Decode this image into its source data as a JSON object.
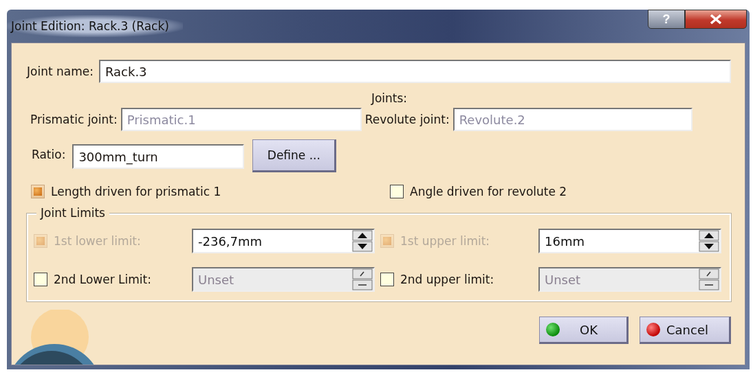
{
  "window": {
    "title": "Joint Edition: Rack.3 (Rack)",
    "help_button": "?"
  },
  "joint_name": {
    "label": "Joint name:",
    "value": "Rack.3"
  },
  "joints": {
    "heading": "Joints:",
    "fields": [
      {
        "label": "Prismatic joint:",
        "value": "Prismatic.1",
        "disabled": true
      },
      {
        "label": "Revolute joint:",
        "value": "Revolute.2",
        "disabled": true
      }
    ]
  },
  "ratio": {
    "label": "Ratio:",
    "value": "300mm_turn",
    "button": "Define ..."
  },
  "drive_options": [
    {
      "label": "Length driven for prismatic 1",
      "checked": true
    },
    {
      "label": "Angle driven for revolute 2",
      "checked": false
    }
  ],
  "joint_limits": {
    "title": "Joint Limits",
    "limits": [
      {
        "label": "1st lower limit:",
        "checked": true,
        "disabled": true,
        "value": "-236,7mm",
        "value_disabled": false
      },
      {
        "label": "1st upper limit:",
        "checked": true,
        "disabled": true,
        "value": "16mm",
        "value_disabled": false
      },
      {
        "label": "2nd Lower Limit:",
        "checked": false,
        "disabled": false,
        "value": "Unset",
        "value_disabled": true
      },
      {
        "label": "2nd upper limit:",
        "checked": false,
        "disabled": false,
        "value": "Unset",
        "value_disabled": true
      }
    ]
  },
  "buttons": [
    {
      "kind": "ok",
      "label": "OK"
    },
    {
      "kind": "cancel",
      "label": "Cancel"
    }
  ]
}
